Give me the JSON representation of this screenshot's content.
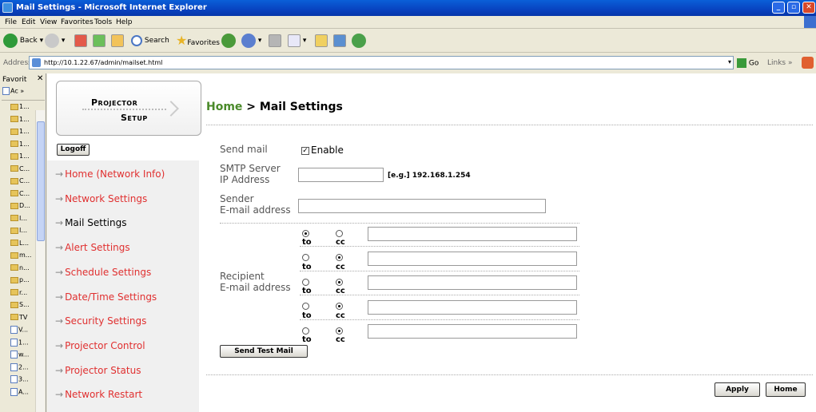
{
  "window": {
    "title": "Mail Settings - Microsoft Internet Explorer"
  },
  "menu": [
    "File",
    "Edit",
    "View",
    "Favorites",
    "Tools",
    "Help"
  ],
  "toolbar": {
    "back_label": "Back",
    "search_label": "Search",
    "favorites_label": "Favorites"
  },
  "address": {
    "label": "Address",
    "url": "http://10.1.22.67/admin/mailset.html",
    "go_label": "Go",
    "links_label": "Links"
  },
  "favorites": {
    "title": "Favorit",
    "add_label": "Ac",
    "items": [
      "1...",
      "1...",
      "1...",
      "1...",
      "1...",
      "C...",
      "C...",
      "C...",
      "D...",
      "I...",
      "I...",
      "L...",
      "m...",
      "n...",
      "p...",
      "r...",
      "S...",
      "TV",
      "V...",
      "1...",
      "w...",
      "2...",
      "3...",
      "A..."
    ]
  },
  "logo": {
    "line1": "Projector",
    "line2": "Setup"
  },
  "logoff_label": "Logoff",
  "nav": [
    {
      "label": "Home (Network Info)",
      "current": false
    },
    {
      "label": "Network Settings",
      "current": false
    },
    {
      "label": "Mail Settings",
      "current": true
    },
    {
      "label": "Alert Settings",
      "current": false
    },
    {
      "label": "Schedule Settings",
      "current": false
    },
    {
      "label": "Date/Time Settings",
      "current": false
    },
    {
      "label": "Security Settings",
      "current": false
    },
    {
      "label": "Projector Control",
      "current": false
    },
    {
      "label": "Projector Status",
      "current": false
    },
    {
      "label": "Network Restart",
      "current": false
    }
  ],
  "heading": {
    "home": "Home",
    "sep": " > ",
    "page": "Mail Settings"
  },
  "form": {
    "send_mail_label": "Send mail",
    "enable_label": "Enable",
    "enable_checked": true,
    "smtp_label_1": "SMTP Server",
    "smtp_label_2": "IP Address",
    "smtp_value": "",
    "smtp_example": "[e.g.] 192.168.1.254",
    "sender_label_1": "Sender",
    "sender_label_2": "E-mail address",
    "sender_value": "",
    "recipient_label_1": "Recipient",
    "recipient_label_2": "E-mail address",
    "to_label": "to",
    "cc_label": "cc",
    "recipients": [
      {
        "selected": "to",
        "value": ""
      },
      {
        "selected": "cc",
        "value": ""
      },
      {
        "selected": "cc",
        "value": ""
      },
      {
        "selected": "cc",
        "value": ""
      },
      {
        "selected": "cc",
        "value": ""
      }
    ],
    "send_test_label": "Send Test Mail"
  },
  "actions": {
    "apply_label": "Apply",
    "home_label": "Home"
  }
}
